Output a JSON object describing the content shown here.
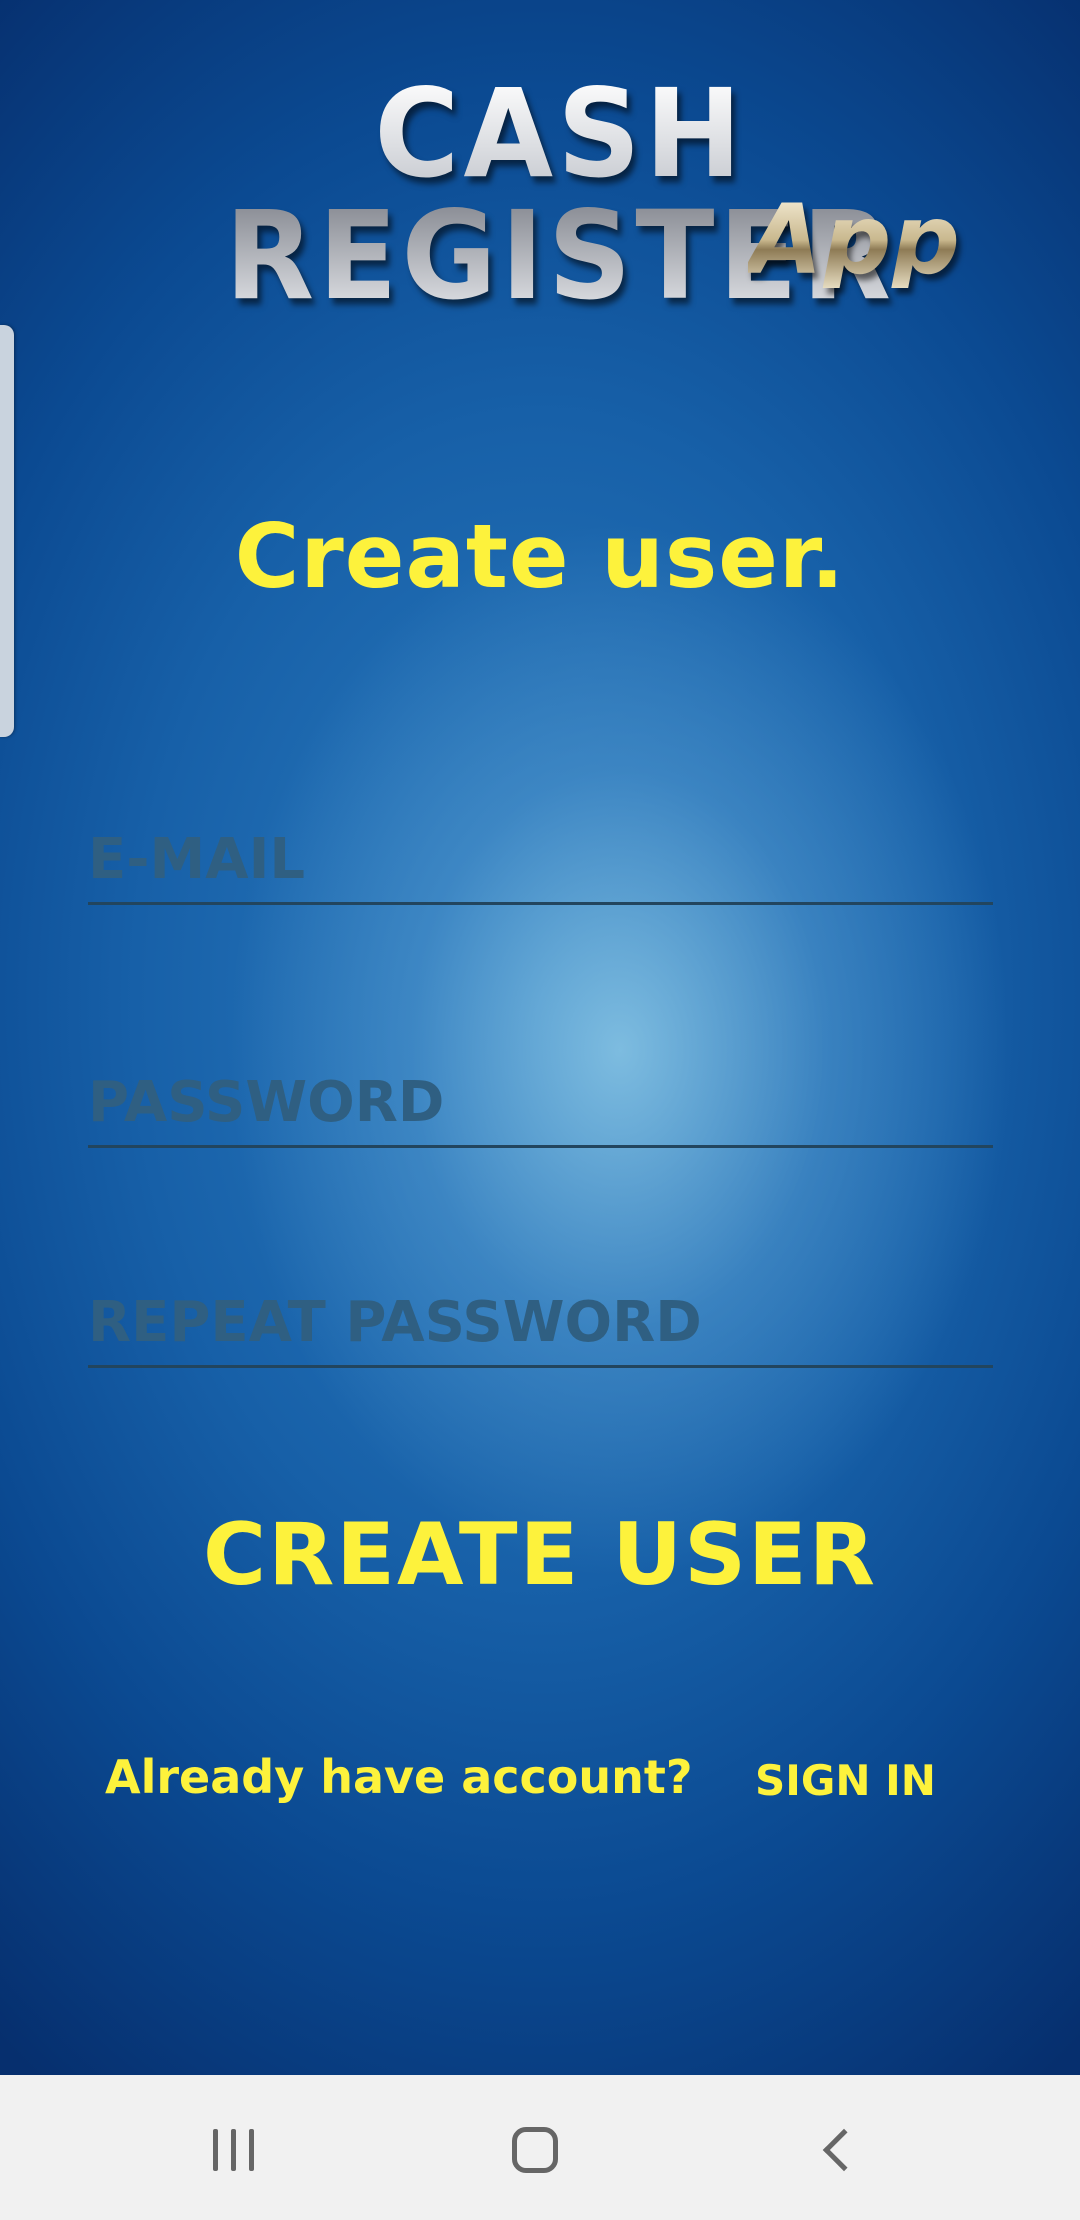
{
  "logo": {
    "main": "CASH REGISTER",
    "sub": "App"
  },
  "heading": "Create user.",
  "form": {
    "email_placeholder": "E-MAIL",
    "password_placeholder": "PASSWORD",
    "repeat_password_placeholder": "REPEAT PASSWORD",
    "create_button": "CREATE USER"
  },
  "footer": {
    "already_text": "Already have account?",
    "signin_label": "SIGN IN"
  },
  "navbar": {
    "icons": [
      "recent-apps-icon",
      "home-icon",
      "back-icon"
    ]
  },
  "colors": {
    "accent_yellow": "#fdf23c",
    "field_text": "#2f5f82",
    "field_line": "#22455e",
    "navbar_bg": "#f1f1f1"
  }
}
